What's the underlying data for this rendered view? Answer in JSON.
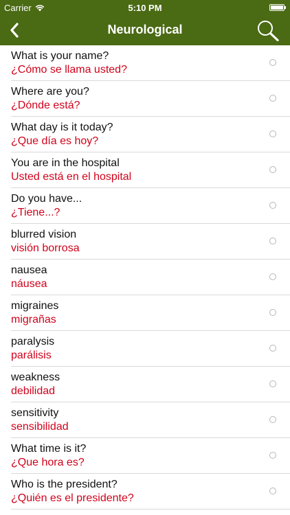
{
  "status_bar": {
    "carrier": "Carrier",
    "time": "5:10 PM"
  },
  "nav": {
    "title": "Neurological"
  },
  "phrases": [
    {
      "english": "What is your name?",
      "spanish": "¿Cómo se llama usted?"
    },
    {
      "english": "Where are you?",
      "spanish": "¿Dónde está?"
    },
    {
      "english": "What day is it today?",
      "spanish": "¿Que día es hoy?"
    },
    {
      "english": "You are in the hospital",
      "spanish": "Usted está en el hospital"
    },
    {
      "english": "Do you have...",
      "spanish": "¿Tiene...?"
    },
    {
      "english": "blurred vision",
      "spanish": "visión borrosa"
    },
    {
      "english": "nausea",
      "spanish": "náusea"
    },
    {
      "english": "migraines",
      "spanish": "migrañas"
    },
    {
      "english": "paralysis",
      "spanish": "parálisis"
    },
    {
      "english": "weakness",
      "spanish": "debilidad"
    },
    {
      "english": "sensitivity",
      "spanish": "sensibilidad"
    },
    {
      "english": "What time is it?",
      "spanish": "¿Que hora es?"
    },
    {
      "english": "Who is the president?",
      "spanish": "¿Quién es el presidente?"
    }
  ],
  "colors": {
    "nav_background": "#4a6a14",
    "spanish_text": "#d0021b"
  },
  "icons": {
    "back": "chevron-left-icon",
    "search": "magnifier-icon",
    "wifi": "wifi-icon",
    "battery": "battery-icon",
    "row_selector": "radio-circle-icon"
  }
}
